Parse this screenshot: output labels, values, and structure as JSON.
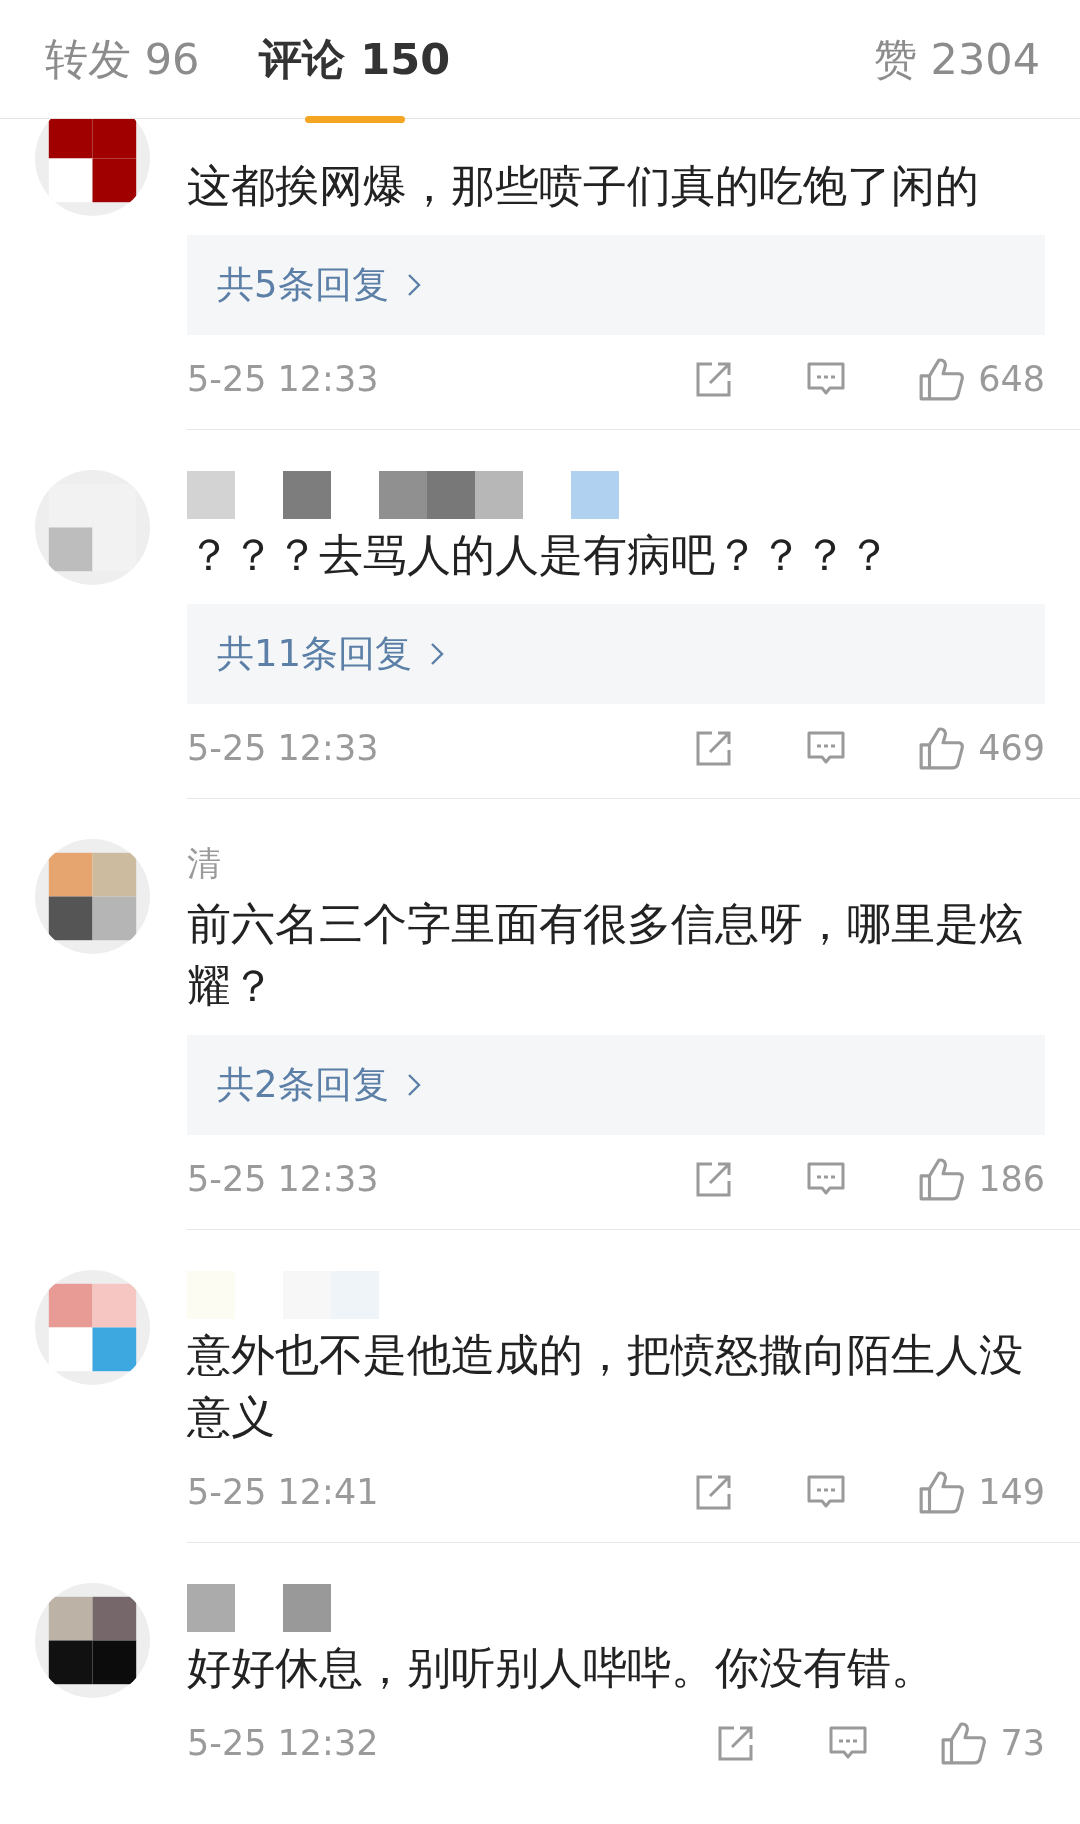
{
  "tabs": [
    {
      "label": "转发 96",
      "selected": false
    },
    {
      "label": "评论 150",
      "selected": true
    },
    {
      "label": "赞 2304",
      "selected": false
    }
  ],
  "comments": [
    {
      "text": "这都挨网爆，那些喷子们真的吃饱了闲的",
      "replies": "共5条回复",
      "time": "5-25 12:33",
      "likes": "648"
    },
    {
      "text": "？？？去骂人的人是有病吧？？？？",
      "replies": "共11条回复",
      "time": "5-25 12:33",
      "likes": "469"
    },
    {
      "name_fragment": "清",
      "text": "前六名三个字里面有很多信息呀，哪里是炫耀？",
      "replies": "共2条回复",
      "time": "5-25 12:33",
      "likes": "186"
    },
    {
      "text": "意外也不是他造成的，把愤怒撒向陌生人没意义",
      "time": "5-25 12:41",
      "likes": "149"
    },
    {
      "text": "好好休息，别听别人哔哔。你没有错。",
      "time": "5-25 12:32",
      "likes": "73"
    }
  ]
}
